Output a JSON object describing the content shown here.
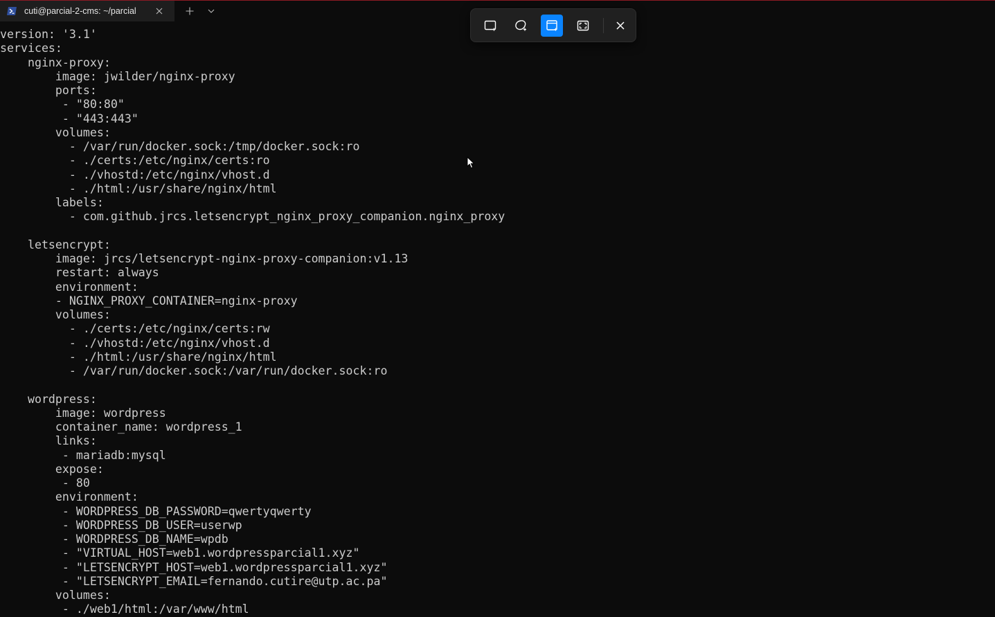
{
  "window": {
    "tab_title": "cuti@parcial-2-cms: ~/parcial",
    "tab_icon": "powershell-icon",
    "accent_color": "#8c1a24"
  },
  "snip_toolbar": {
    "buttons": [
      {
        "icon": "rectangle-snip-icon",
        "active": false
      },
      {
        "icon": "freeform-snip-icon",
        "active": false
      },
      {
        "icon": "window-snip-icon",
        "active": true
      },
      {
        "icon": "fullscreen-snip-icon",
        "active": false
      },
      {
        "icon": "close-icon",
        "active": false
      }
    ],
    "active_color": "#0a84ff"
  },
  "terminal": {
    "text_color": "#cccccc",
    "lines": [
      "version: '3.1'",
      "services:",
      "    nginx-proxy:",
      "        image: jwilder/nginx-proxy",
      "        ports:",
      "         - \"80:80\"",
      "         - \"443:443\"",
      "        volumes:",
      "          - /var/run/docker.sock:/tmp/docker.sock:ro",
      "          - ./certs:/etc/nginx/certs:ro",
      "          - ./vhostd:/etc/nginx/vhost.d",
      "          - ./html:/usr/share/nginx/html",
      "        labels:",
      "          - com.github.jrcs.letsencrypt_nginx_proxy_companion.nginx_proxy",
      "",
      "    letsencrypt:",
      "        image: jrcs/letsencrypt-nginx-proxy-companion:v1.13",
      "        restart: always",
      "        environment:",
      "        - NGINX_PROXY_CONTAINER=nginx-proxy",
      "        volumes:",
      "          - ./certs:/etc/nginx/certs:rw",
      "          - ./vhostd:/etc/nginx/vhost.d",
      "          - ./html:/usr/share/nginx/html",
      "          - /var/run/docker.sock:/var/run/docker.sock:ro",
      "",
      "    wordpress:",
      "        image: wordpress",
      "        container_name: wordpress_1",
      "        links:",
      "         - mariadb:mysql",
      "        expose:",
      "         - 80",
      "        environment:",
      "         - WORDPRESS_DB_PASSWORD=qwertyqwerty",
      "         - WORDPRESS_DB_USER=userwp",
      "         - WORDPRESS_DB_NAME=wpdb",
      "         - \"VIRTUAL_HOST=web1.wordpressparcial1.xyz\"",
      "         - \"LETSENCRYPT_HOST=web1.wordpressparcial1.xyz\"",
      "         - \"LETSENCRYPT_EMAIL=fernando.cutire@utp.ac.pa\"",
      "        volumes:",
      "         - ./web1/html:/var/www/html"
    ]
  }
}
